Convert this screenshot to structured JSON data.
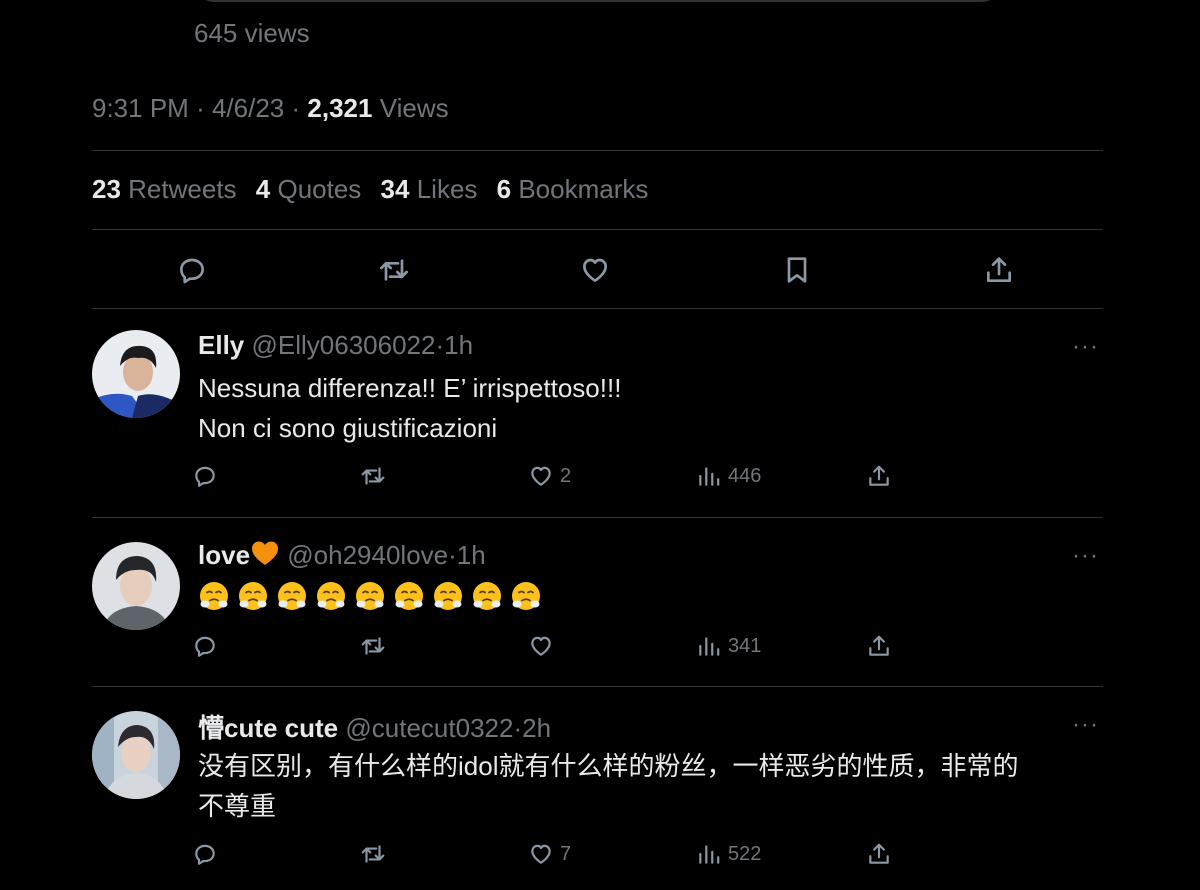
{
  "quoted_tweet": {
    "views_label": "645 views"
  },
  "tweet_meta": {
    "time": "9:31 PM",
    "date": "4/6/23",
    "views_count": "2,321",
    "views_label": "Views",
    "separator": "·"
  },
  "engagement": {
    "retweets_count": "23",
    "retweets_label": "Retweets",
    "quotes_count": "4",
    "quotes_label": "Quotes",
    "likes_count": "34",
    "likes_label": "Likes",
    "bookmarks_count": "6",
    "bookmarks_label": "Bookmarks"
  },
  "main_actions": [
    "reply-icon",
    "retweet-icon",
    "like-icon",
    "bookmark-icon",
    "share-icon"
  ],
  "replies": [
    {
      "name": "Elly",
      "handle": "@Elly06306022",
      "separator": "·",
      "time": "1h",
      "text_lines": [
        "Nessuna differenza!! E’ irrispettoso!!!",
        "Non ci sono giustificazioni"
      ],
      "likes": "2",
      "views": "446"
    },
    {
      "name": "love",
      "name_emoji": "orange-heart",
      "handle": "@oh2940love",
      "separator": "·",
      "time": "1h",
      "emoji_count": 9,
      "emoji": "face-with-steam-from-nose",
      "likes": "",
      "views": "341"
    },
    {
      "name": "懵cute cute",
      "handle": "@cutecut0322",
      "separator": "·",
      "time": "2h",
      "text_lines": [
        "没有区别，有什么样的idol就有什么样的粉丝，一样恶劣的性质，非常的",
        "不尊重"
      ],
      "likes": "7",
      "views": "522"
    }
  ],
  "more_label": "···",
  "colors": {
    "background": "#000000",
    "text": "#e7e9ea",
    "secondary": "#71767b",
    "divider": "#2f3336",
    "icon": "#8b98a5",
    "heart_emoji": "#f4900c"
  }
}
